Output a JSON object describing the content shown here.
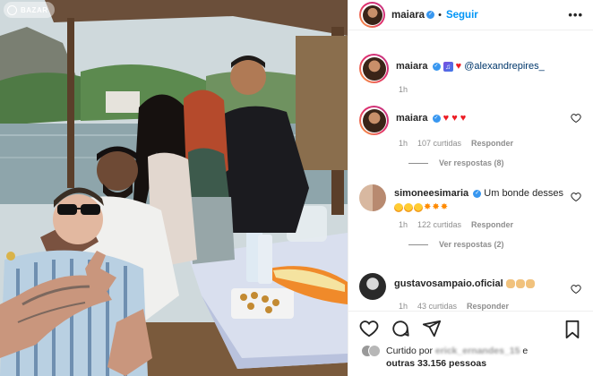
{
  "watermark": {
    "text": "BAZAR"
  },
  "post": {
    "username": "maiara",
    "follow_label": "Seguir",
    "more_label": "•••"
  },
  "caption": {
    "username": "maiara",
    "mention": "@alexandrepires_",
    "time": "1h"
  },
  "comments": [
    {
      "username": "maiara",
      "time": "1h",
      "likes": "107 curtidas",
      "reply_label": "Responder",
      "view_replies": "Ver respostas (8)"
    },
    {
      "username": "simoneesimaria",
      "text": "Um bonde desses",
      "time": "1h",
      "likes": "122 curtidas",
      "reply_label": "Responder",
      "view_replies": "Ver respostas (2)"
    },
    {
      "username": "gustavosampaio.oficial",
      "time": "1h",
      "likes": "43 curtidas",
      "reply_label": "Responder"
    }
  ],
  "liked_by": {
    "prefix": "Curtido por",
    "first_user": "erick_ernandes_15",
    "and": "e",
    "others": "outras 33.156 pessoas"
  },
  "icons": [
    "verified-icon",
    "more-icon",
    "heart-icon",
    "comment-icon",
    "share-icon",
    "bookmark-icon",
    "music-note-icon"
  ],
  "colors": {
    "link": "#0095f6",
    "verified": "#3897f0",
    "heart": "#ed1c24",
    "meta": "#8e8e8e"
  }
}
